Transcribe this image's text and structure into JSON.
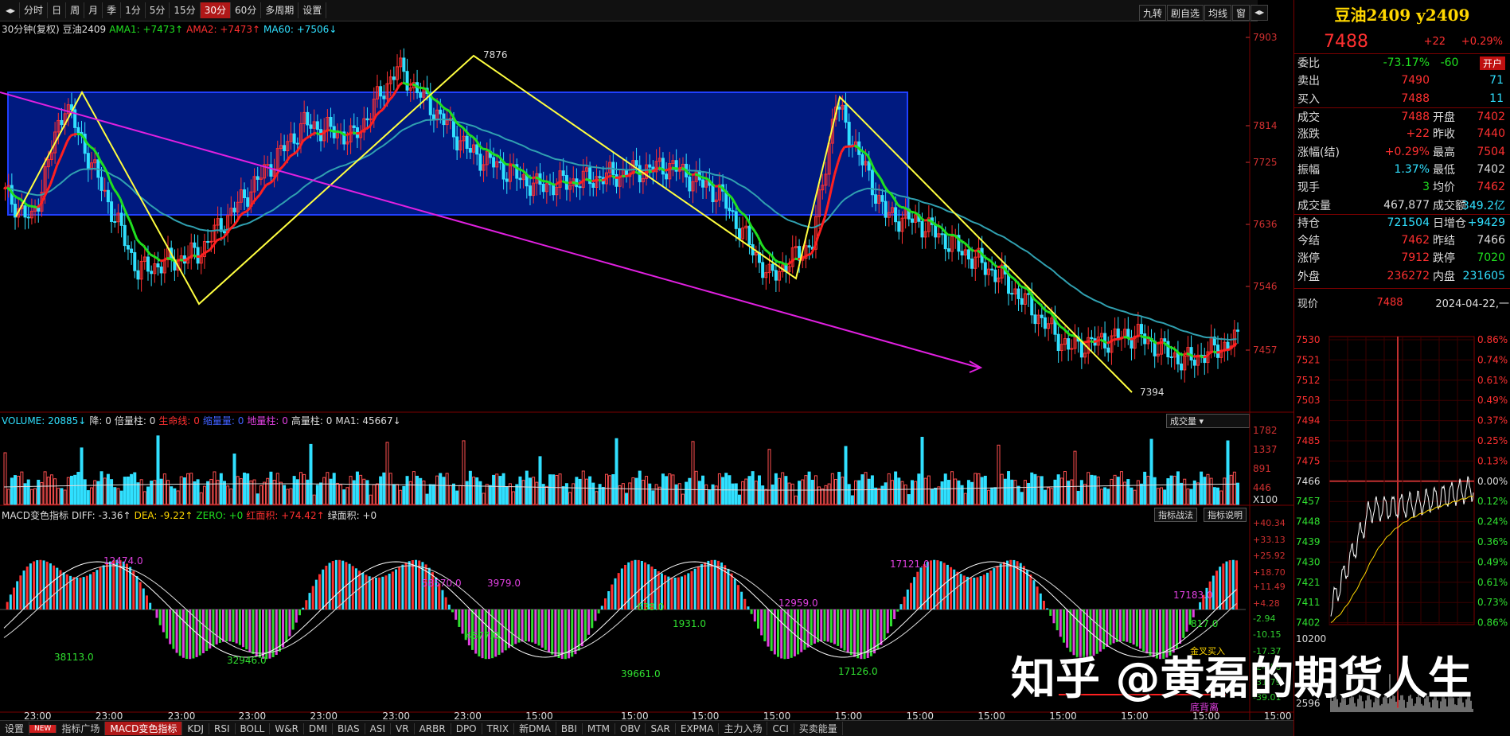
{
  "toolbar": {
    "periods": [
      "分时",
      "日",
      "周",
      "月",
      "季",
      "1分",
      "5分",
      "15分",
      "30分",
      "60分",
      "多周期",
      "设置"
    ],
    "active": "30分",
    "right": [
      "九转",
      "剧自选",
      "均线",
      "窗"
    ]
  },
  "main_legend": {
    "name": "30分钟(复权)",
    "symbol": "豆油2409",
    "ama1": "AMA1: +7473↑",
    "ama2": "AMA2: +7473↑",
    "ma60": "MA60: +7506↓"
  },
  "price_axis": [
    "7903",
    "7814",
    "7725",
    "7636",
    "7546",
    "7457"
  ],
  "annotations": {
    "high": "7876",
    "low": "7394"
  },
  "volume_legend": {
    "vol": "VOLUME: 20885↓",
    "jiang": "降: 0",
    "beiliang": "倍量柱: 0",
    "shengming": "生命线: 0",
    "suoliang": "缩量量: 0",
    "diliang": "地量柱: 0",
    "gaoliang": "高量柱: 0",
    "ma1": "MA1: 45667↓"
  },
  "volume_dropdown": "成交量",
  "volume_axis": [
    "1782",
    "1337",
    "891",
    "446",
    "X100"
  ],
  "macd_legend": {
    "name": "MACD变色指标",
    "diff": "DIFF: -3.36↑",
    "dea": "DEA: -9.22↑",
    "zero": "ZERO: +0",
    "red": "红面积: +74.42↑",
    "green": "绿面积: +0"
  },
  "macd_buttons": [
    "指标战法",
    "指标说明"
  ],
  "macd_axis": [
    "+40.34",
    "+33.13",
    "+25.92",
    "+18.70",
    "+11.49",
    "+4.28",
    "-2.94",
    "-10.15",
    "-17.37",
    "-24.58",
    "-31.79",
    "-39.01"
  ],
  "macd_labels": [
    "12474.0",
    "38113.0",
    "32946.0",
    "58570.0",
    "3979.0",
    "4677.0",
    "638.0",
    "1931.0",
    "39661.0",
    "12959.0",
    "17121.0",
    "17126.0",
    "17183.0",
    "817.0"
  ],
  "macd_marks": {
    "jincha": "金叉买入",
    "dibeili": "底背离"
  },
  "time_axis": [
    "23:00",
    "23:00",
    "23:00",
    "23:00",
    "23:00",
    "23:00",
    "23:00",
    "15:00",
    "15:00",
    "15:00",
    "15:00",
    "15:00",
    "15:00",
    "15:00",
    "15:00",
    "15:00",
    "15:00",
    "15:00"
  ],
  "bottom_tabs": [
    "设置",
    "NEW",
    "指标广场",
    "MACD变色指标",
    "KDJ",
    "RSI",
    "BOLL",
    "W&R",
    "DMI",
    "BIAS",
    "ASI",
    "VR",
    "ARBR",
    "DPO",
    "TRIX",
    "新DMA",
    "BBI",
    "MTM",
    "OBV",
    "SAR",
    "EXPMA",
    "主力入场",
    "CCI",
    "买卖能量"
  ],
  "quote": {
    "title": "豆油2409 y2409",
    "price": "7488",
    "change": "+22",
    "pct": "+0.29%",
    "rows": [
      [
        "委比",
        "-73.17%",
        "-60",
        "开户"
      ],
      [
        "卖出",
        "7490",
        "71"
      ],
      [
        "买入",
        "7488",
        "11"
      ],
      [
        "成交",
        "7488",
        "开盘",
        "7402"
      ],
      [
        "涨跌",
        "+22",
        "昨收",
        "7440"
      ],
      [
        "涨幅(结)",
        "+0.29%",
        "最高",
        "7504"
      ],
      [
        "振幅",
        "1.37%",
        "最低",
        "7402"
      ],
      [
        "现手",
        "3",
        "均价",
        "7462"
      ],
      [
        "成交量",
        "467,877",
        "成交额",
        "349.2亿"
      ],
      [
        "持仓",
        "721504",
        "日增仓",
        "+9429"
      ],
      [
        "今结",
        "7462",
        "昨结",
        "7466"
      ],
      [
        "涨停",
        "7912",
        "跌停",
        "7020"
      ],
      [
        "外盘",
        "236272",
        "内盘",
        "231605"
      ]
    ]
  },
  "mini": {
    "label": "现价",
    "price": "7488",
    "date": "2024-04-22,一",
    "left_axis": [
      "7530",
      "7521",
      "7512",
      "7503",
      "7494",
      "7485",
      "7475",
      "7466",
      "7457",
      "7448",
      "7439",
      "7430",
      "7421",
      "7411",
      "7402"
    ],
    "right_axis": [
      "0.86%",
      "0.74%",
      "0.61%",
      "0.49%",
      "0.37%",
      "0.25%",
      "0.13%",
      "0.00%",
      "0.12%",
      "0.24%",
      "0.36%",
      "0.49%",
      "0.61%",
      "0.73%",
      "0.86%"
    ],
    "vol_top": "10200",
    "vol_bot": "2596"
  },
  "watermark": "知乎 @黄磊的期货人生",
  "colors": {
    "up": "#ff3030",
    "down": "#30e0ff",
    "ama": "#20e020",
    "ma60": "#30a0b0",
    "box": "#001a80",
    "zigzag": "#ffff40",
    "trend": "#e020e0"
  }
}
